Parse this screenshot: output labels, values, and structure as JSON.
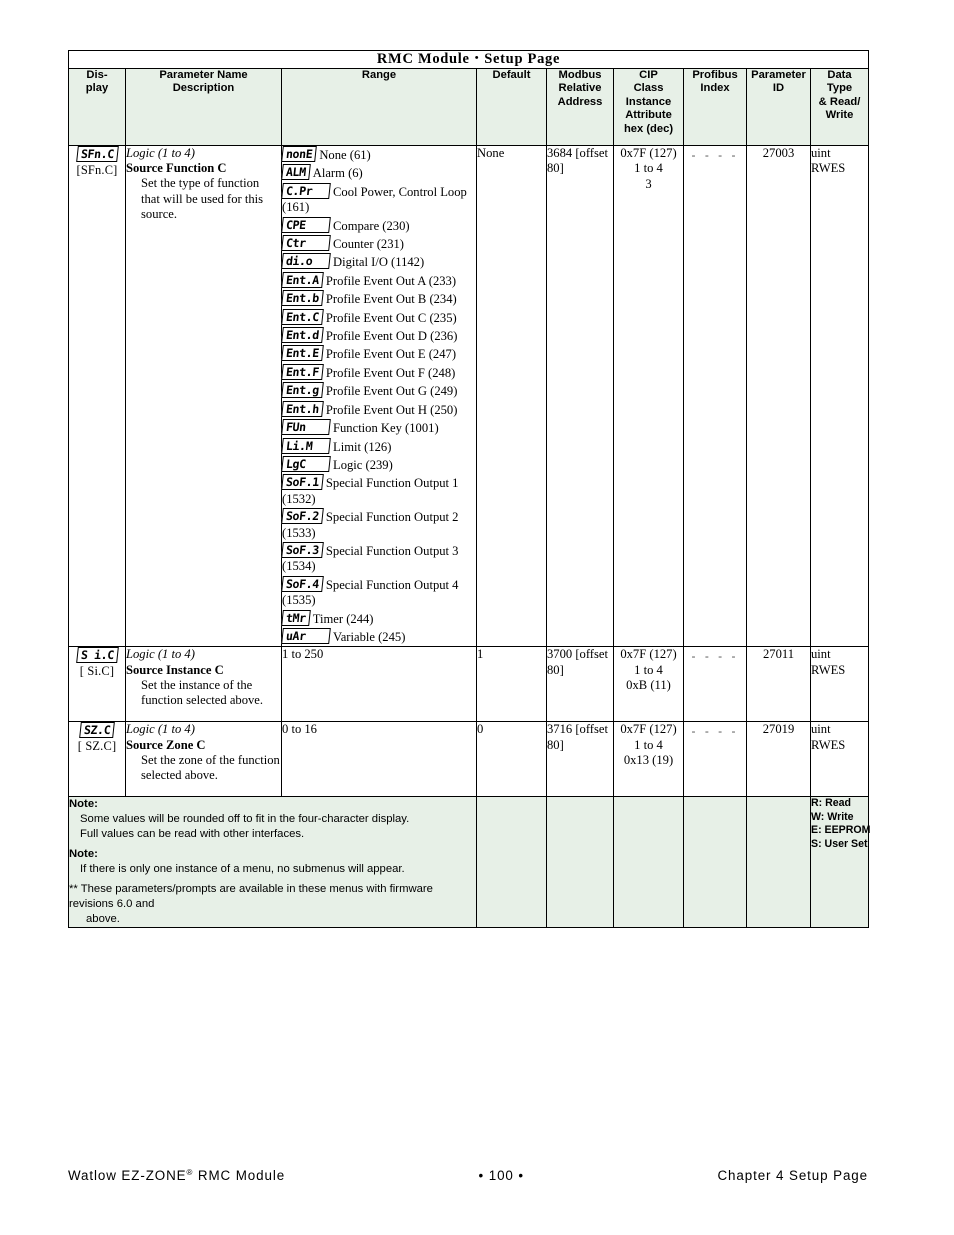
{
  "title": {
    "left": "RMC Module",
    "separator": "•",
    "right": "Setup Page"
  },
  "columns": [
    {
      "id": "display",
      "label": "Dis-\nplay"
    },
    {
      "id": "parameter",
      "label": "Parameter Name\nDescription"
    },
    {
      "id": "range",
      "label": "Range"
    },
    {
      "id": "default",
      "label": "Default"
    },
    {
      "id": "modbus",
      "label": "Modbus\nRelative\nAddress"
    },
    {
      "id": "cip",
      "label": "CIP\nClass\nInstance\nAttribute\nhex (dec)"
    },
    {
      "id": "profibus",
      "label": "Profibus\nIndex"
    },
    {
      "id": "parameter_id",
      "label": "Parameter\nID"
    },
    {
      "id": "datatype",
      "label": "Data\nType\n& Read/\nWrite"
    }
  ],
  "column_headers": {
    "display_l1": "Dis-",
    "display_l2": "play",
    "parameter_l1": "Parameter Name",
    "parameter_l2": "Description",
    "range": "Range",
    "default": "Default",
    "modbus_l1": "Modbus",
    "modbus_l2": "Relative",
    "modbus_l3": "Address",
    "cip_l1": "CIP",
    "cip_l2": "Class",
    "cip_l3": "Instance",
    "cip_l4": "Attribute",
    "cip_l5": "hex (dec)",
    "profibus_l1": "Profibus",
    "profibus_l2": "Index",
    "paramid_l1": "Parameter",
    "paramid_l2": "ID",
    "datatype_l1": "Data",
    "datatype_l2": "Type",
    "datatype_l3": "& Read/",
    "datatype_l4": "Write"
  },
  "rows": [
    {
      "display_seg": "SFn.C",
      "display_alt": "[SFn.C]",
      "context": "Logic (1 to 4)",
      "name": "Source Function C",
      "description": "Set the type of function that will be used for this source.",
      "range_items": [
        {
          "seg": "nonE",
          "text": "None (61)"
        },
        {
          "seg": "ALM",
          "text": "Alarm (6)"
        },
        {
          "seg": "C.Pr",
          "text": "Cool Power, Control Loop (161)"
        },
        {
          "seg": "CPE",
          "text": "Compare (230)"
        },
        {
          "seg": "Ctr",
          "text": "Counter (231)"
        },
        {
          "seg": "di.o",
          "text": "Digital I/O (1142)"
        },
        {
          "seg": "Ent.A",
          "text": "Profile Event Out A (233)"
        },
        {
          "seg": "Ent.b",
          "text": "Profile Event Out B (234)"
        },
        {
          "seg": "Ent.C",
          "text": "Profile Event Out C (235)"
        },
        {
          "seg": "Ent.d",
          "text": "Profile Event Out D (236)"
        },
        {
          "seg": "Ent.E",
          "text": "Profile Event Out E (247)"
        },
        {
          "seg": "Ent.F",
          "text": "Profile Event Out F (248)"
        },
        {
          "seg": "Ent.g",
          "text": "Profile Event Out G (249)"
        },
        {
          "seg": "Ent.h",
          "text": "Profile Event Out H (250)"
        },
        {
          "seg": "FUn",
          "text": "Function Key (1001)"
        },
        {
          "seg": "Li.M",
          "text": "Limit (126)"
        },
        {
          "seg": "LgC",
          "text": "Logic (239)"
        },
        {
          "seg": "SoF.1",
          "text": "Special Function Output 1 (1532)"
        },
        {
          "seg": "SoF.2",
          "text": "Special Function Output 2 (1533)"
        },
        {
          "seg": "SoF.3",
          "text": "Special Function Output 3 (1534)"
        },
        {
          "seg": "SoF.4",
          "text": "Special Function Output 4 (1535)"
        },
        {
          "seg": "tMr",
          "text": "Timer (244)"
        },
        {
          "seg": "uAr",
          "text": "Variable (245)"
        }
      ],
      "range_plain": "",
      "default": "None",
      "modbus_l1": "3684",
      "modbus_l2": "[offset 80]",
      "cip_l1": "0x7F (127)",
      "cip_l2": "1 to 4",
      "cip_l3": "3",
      "profibus": "- - - -",
      "parameter_id": "27003",
      "datatype_l1": "uint",
      "datatype_l2": "RWES"
    },
    {
      "display_seg": "S i.C",
      "display_alt": "[ Si.C]",
      "context": "Logic (1 to 4)",
      "name": "Source Instance C",
      "description": "Set the instance of the function selected above.",
      "range_items": [],
      "range_plain": "1 to 250",
      "default": "1",
      "modbus_l1": "3700",
      "modbus_l2": "[offset 80]",
      "cip_l1": "0x7F (127)",
      "cip_l2": "1 to 4",
      "cip_l3": "0xB (11)",
      "profibus": "- - - -",
      "parameter_id": "27011",
      "datatype_l1": "uint",
      "datatype_l2": "RWES"
    },
    {
      "display_seg": "SZ.C",
      "display_alt": "[ SZ.C]",
      "context": "Logic (1 to 4)",
      "name": "Source Zone C",
      "description": "Set the zone of the function selected above.",
      "range_items": [],
      "range_plain": "0 to 16",
      "default": "0",
      "modbus_l1": "3716",
      "modbus_l2": "[offset 80]",
      "cip_l1": "0x7F (127)",
      "cip_l2": "1 to 4",
      "cip_l3": "0x13 (19)",
      "profibus": "- - - -",
      "parameter_id": "27019",
      "datatype_l1": "uint",
      "datatype_l2": "RWES"
    }
  ],
  "notes": {
    "note1_label": "Note:",
    "note1_line1": "Some values will be rounded off to fit in the four-character display.",
    "note1_line2": "Full values can be read with other interfaces.",
    "note2_label": "Note:",
    "note2_line1": "If there is only one instance of a menu, no submenus will appear.",
    "footnote_line1": "** These parameters/prompts are available in these menus with firmware revisions 6.0 and",
    "footnote_line2": "above."
  },
  "legend": {
    "read": "R: Read",
    "write": "W: Write",
    "eeprom": "E: EEPROM",
    "userset": "S: User Set"
  },
  "footer": {
    "left_pre": "Watlow EZ-ZONE",
    "left_sup": "®",
    "left_post": " RMC Module",
    "center": "•  100  •",
    "right": "Chapter 4 Setup Page"
  },
  "colors": {
    "header_bg": "#e7f0e7",
    "border": "#000000",
    "text": "#000000",
    "page_bg": "#ffffff"
  }
}
